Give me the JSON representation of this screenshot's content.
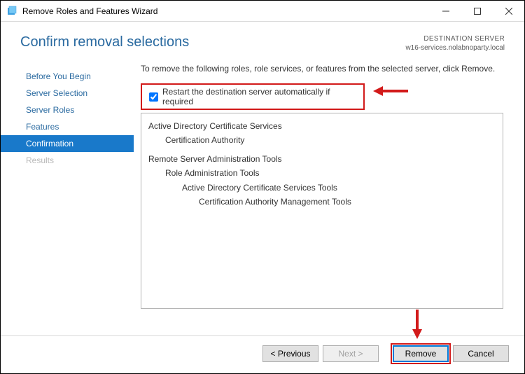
{
  "window": {
    "title": "Remove Roles and Features Wizard"
  },
  "header": {
    "title": "Confirm removal selections",
    "dest_label": "DESTINATION SERVER",
    "dest_server": "w16-services.nolabnoparty.local"
  },
  "sidebar": {
    "items": [
      {
        "label": "Before You Begin",
        "kind": "link"
      },
      {
        "label": "Server Selection",
        "kind": "link"
      },
      {
        "label": "Server Roles",
        "kind": "link"
      },
      {
        "label": "Features",
        "kind": "link"
      },
      {
        "label": "Confirmation",
        "kind": "selected"
      },
      {
        "label": "Results",
        "kind": "disabled"
      }
    ]
  },
  "content": {
    "instruction": "To remove the following roles, role services, or features from the selected server, click Remove.",
    "restart_label": "Restart the destination server automatically if required",
    "restart_checked": true,
    "roles": [
      {
        "text": "Active Directory Certificate Services",
        "indent": 0
      },
      {
        "text": "Certification Authority",
        "indent": 1
      },
      {
        "text": "Remote Server Administration Tools",
        "indent": 0
      },
      {
        "text": "Role Administration Tools",
        "indent": 1
      },
      {
        "text": "Active Directory Certificate Services Tools",
        "indent": 2
      },
      {
        "text": "Certification Authority Management Tools",
        "indent": 3
      }
    ]
  },
  "buttons": {
    "previous": "< Previous",
    "next": "Next >",
    "remove": "Remove",
    "cancel": "Cancel"
  }
}
